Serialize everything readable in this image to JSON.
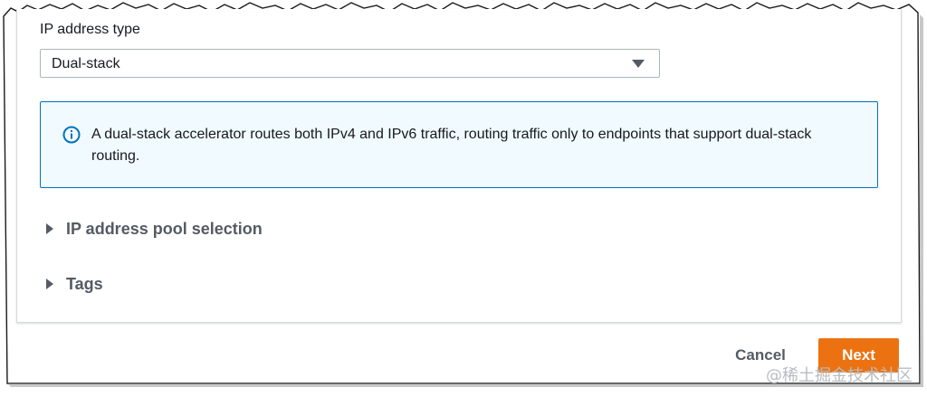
{
  "form": {
    "ip_address_type_label": "IP address type",
    "ip_address_type_value": "Dual-stack",
    "info_alert_text": "A dual-stack accelerator routes both IPv4 and IPv6 traffic, routing traffic only to endpoints that support dual-stack routing.",
    "sections": [
      {
        "label": "IP address pool selection",
        "expanded": false
      },
      {
        "label": "Tags",
        "expanded": false
      }
    ]
  },
  "actions": {
    "cancel_label": "Cancel",
    "next_label": "Next"
  },
  "watermark": "@稀土掘金技术社区",
  "icons": {
    "info": "info-icon",
    "dropdown": "caret-down-icon",
    "expand": "caret-right-icon"
  },
  "colors": {
    "primary_button": "#ec7211",
    "info_border": "#0073bb",
    "info_background": "#f1faff",
    "text": "#16191f",
    "secondary_text": "#545b64"
  }
}
